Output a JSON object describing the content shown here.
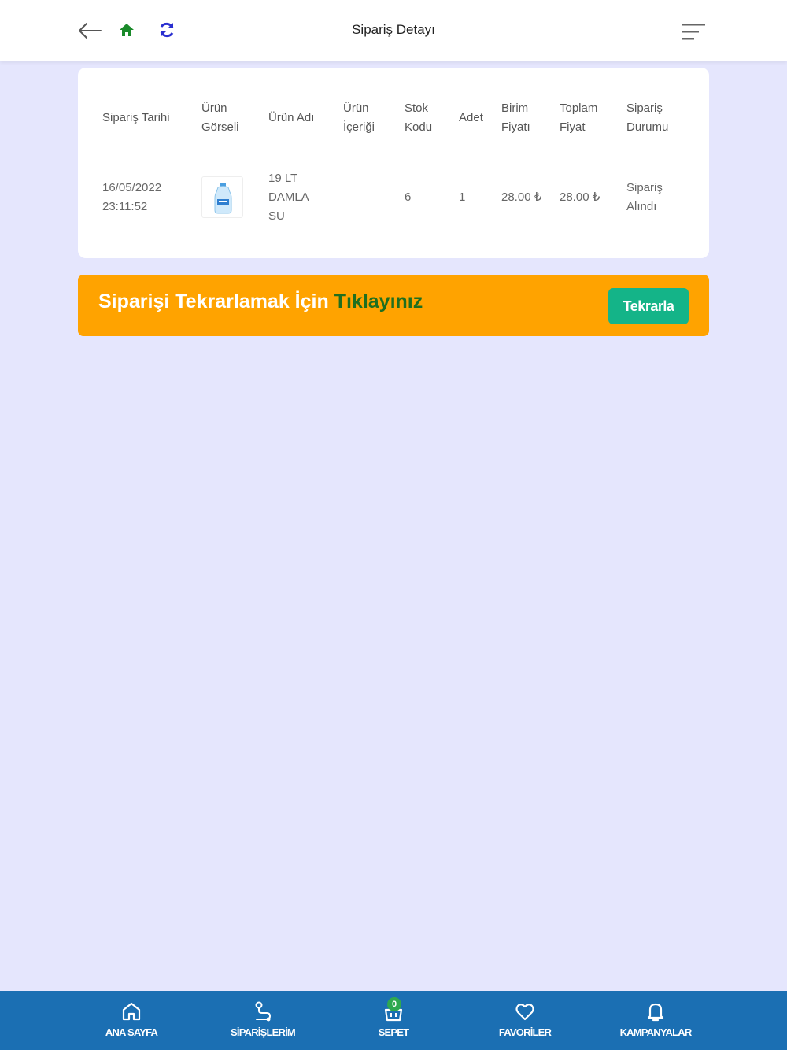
{
  "header": {
    "title": "Sipariş Detayı",
    "icons": [
      "back-arrow-icon",
      "home-icon",
      "refresh-icon",
      "menu-icon"
    ]
  },
  "table": {
    "headers": {
      "date": "Sipariş Tarihi",
      "image_line1": "Ürün",
      "image_line2": "Görseli",
      "name": "Ürün Adı",
      "content_line1": "Ürün",
      "content_line2": "İçeriği",
      "stock_line1": "Stok",
      "stock_line2": "Kodu",
      "qty": "Adet",
      "unit_line1": "Birim",
      "unit_line2": "Fiyatı",
      "total_line1": "Toplam",
      "total_line2": "Fiyat",
      "status_line1": "Sipariş",
      "status_line2": "Durumu"
    },
    "rows": [
      {
        "date_line1": "16/05/2022",
        "date_line2": "23:11:52",
        "name_line1": "19 LT",
        "name_line2": "DAMLA",
        "name_line3": "SU",
        "content": "",
        "stock_code": "6",
        "qty": "1",
        "unit_price": "28.00 ₺",
        "total_price": "28.00 ₺",
        "status_line1": "Sipariş",
        "status_line2": "Alındı"
      }
    ]
  },
  "banner": {
    "text": "Siparişi Tekrarlamak İçin",
    "highlight": "Tıklayınız",
    "button": "Tekrarla"
  },
  "bottom_nav": {
    "home": "ANA SAYFA",
    "orders": "SİPARİŞLERİM",
    "cart": "SEPET",
    "cart_count": "0",
    "favorites": "FAVORİLER",
    "campaigns": "KAMPANYALAR"
  },
  "colors": {
    "page_bg": "#e5e6fd",
    "banner": "#ffa300",
    "button": "#14b488",
    "highlight": "#1f6f1f",
    "nav_bg": "#1b6fb3"
  }
}
